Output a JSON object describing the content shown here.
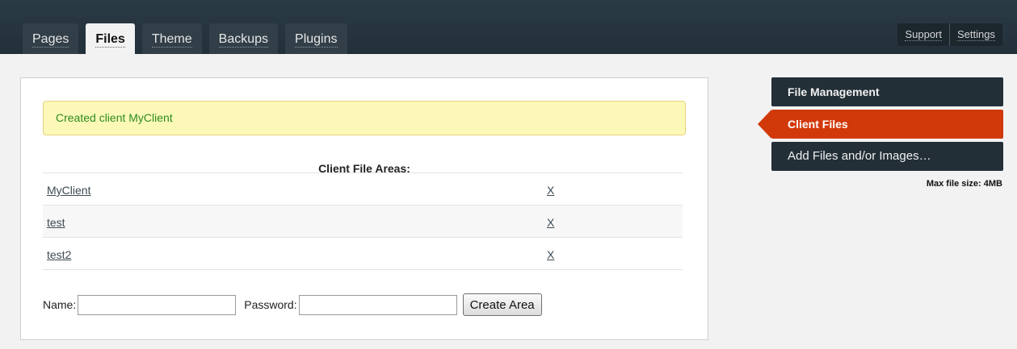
{
  "tabs": [
    {
      "label": "Pages"
    },
    {
      "label": "Files"
    },
    {
      "label": "Theme"
    },
    {
      "label": "Backups"
    },
    {
      "label": "Plugins"
    }
  ],
  "utility": {
    "support": "Support",
    "settings": "Settings"
  },
  "notice": "Created client MyClient",
  "areas": {
    "title": "Client File Areas:",
    "rows": [
      {
        "name": "MyClient",
        "delete": "X"
      },
      {
        "name": "test",
        "delete": "X"
      },
      {
        "name": "test2",
        "delete": "X"
      }
    ]
  },
  "form": {
    "name_label": "Name:",
    "name_value": "",
    "password_label": "Password:",
    "password_value": "",
    "submit": "Create Area"
  },
  "sidebar": {
    "items": [
      {
        "label": "File Management"
      },
      {
        "label": "Client Files"
      },
      {
        "label": "Add Files and/or Images…"
      }
    ],
    "max_label": "Max file size: ",
    "max_value": "4MB"
  },
  "colors": {
    "accent": "#d2390a",
    "topbar": "#2a3a44",
    "notice_text": "#2e8b1f",
    "notice_bg": "#fcf9b8"
  }
}
